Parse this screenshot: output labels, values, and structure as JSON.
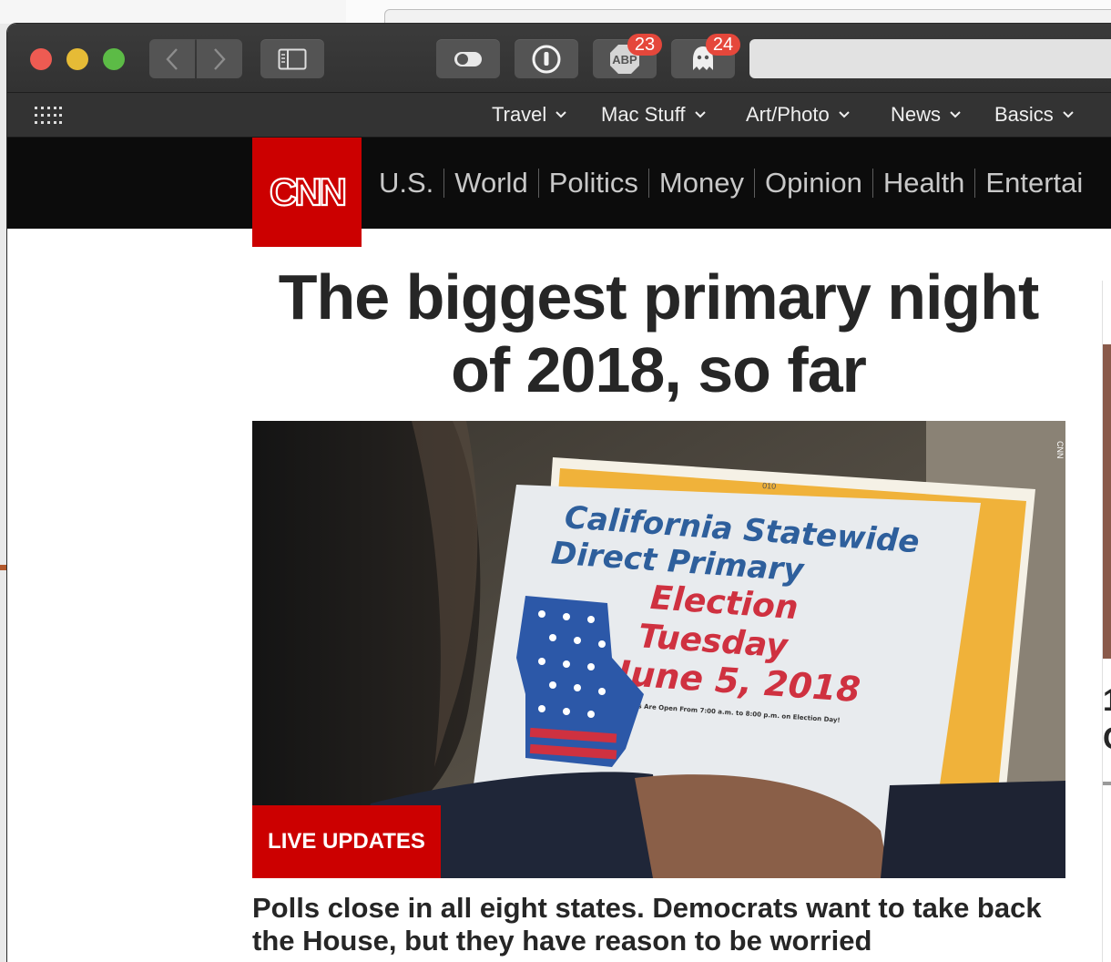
{
  "browser": {
    "badges": {
      "abp": "23",
      "ghostery": "24"
    },
    "abp_label": "ABP",
    "address": "",
    "bookmarks": [
      {
        "label": "Travel"
      },
      {
        "label": "Mac Stuff"
      },
      {
        "label": "Art/Photo"
      },
      {
        "label": "News"
      },
      {
        "label": "Basics"
      }
    ]
  },
  "cnn": {
    "logo_text": "CNN",
    "nav": [
      "U.S.",
      "World",
      "Politics",
      "Money",
      "Opinion",
      "Health",
      "Entertai"
    ]
  },
  "article": {
    "headline": "The biggest primary night of 2018, so far",
    "live_label": "LIVE UPDATES",
    "summary": "Polls close in all eight states. Democrats want to take back the House, but they have reason to be worried",
    "image": {
      "watermark": "CNN",
      "flyer": {
        "number": "010",
        "line1": "California Statewide",
        "line2": "Direct Primary",
        "line3": "Election",
        "line4": "Tuesday",
        "line5": "June 5, 2018",
        "fine_print": "Polls Are Open From 7:00 a.m. to 8:00 p.m. on Election Day!"
      }
    }
  },
  "right_rail": {
    "text_line1": "1",
    "text_line2": "C"
  },
  "colors": {
    "cnn_red": "#cc0000",
    "badge_red": "#e5473b",
    "toolbar_dark": "#333333",
    "headline_text": "#262626"
  }
}
